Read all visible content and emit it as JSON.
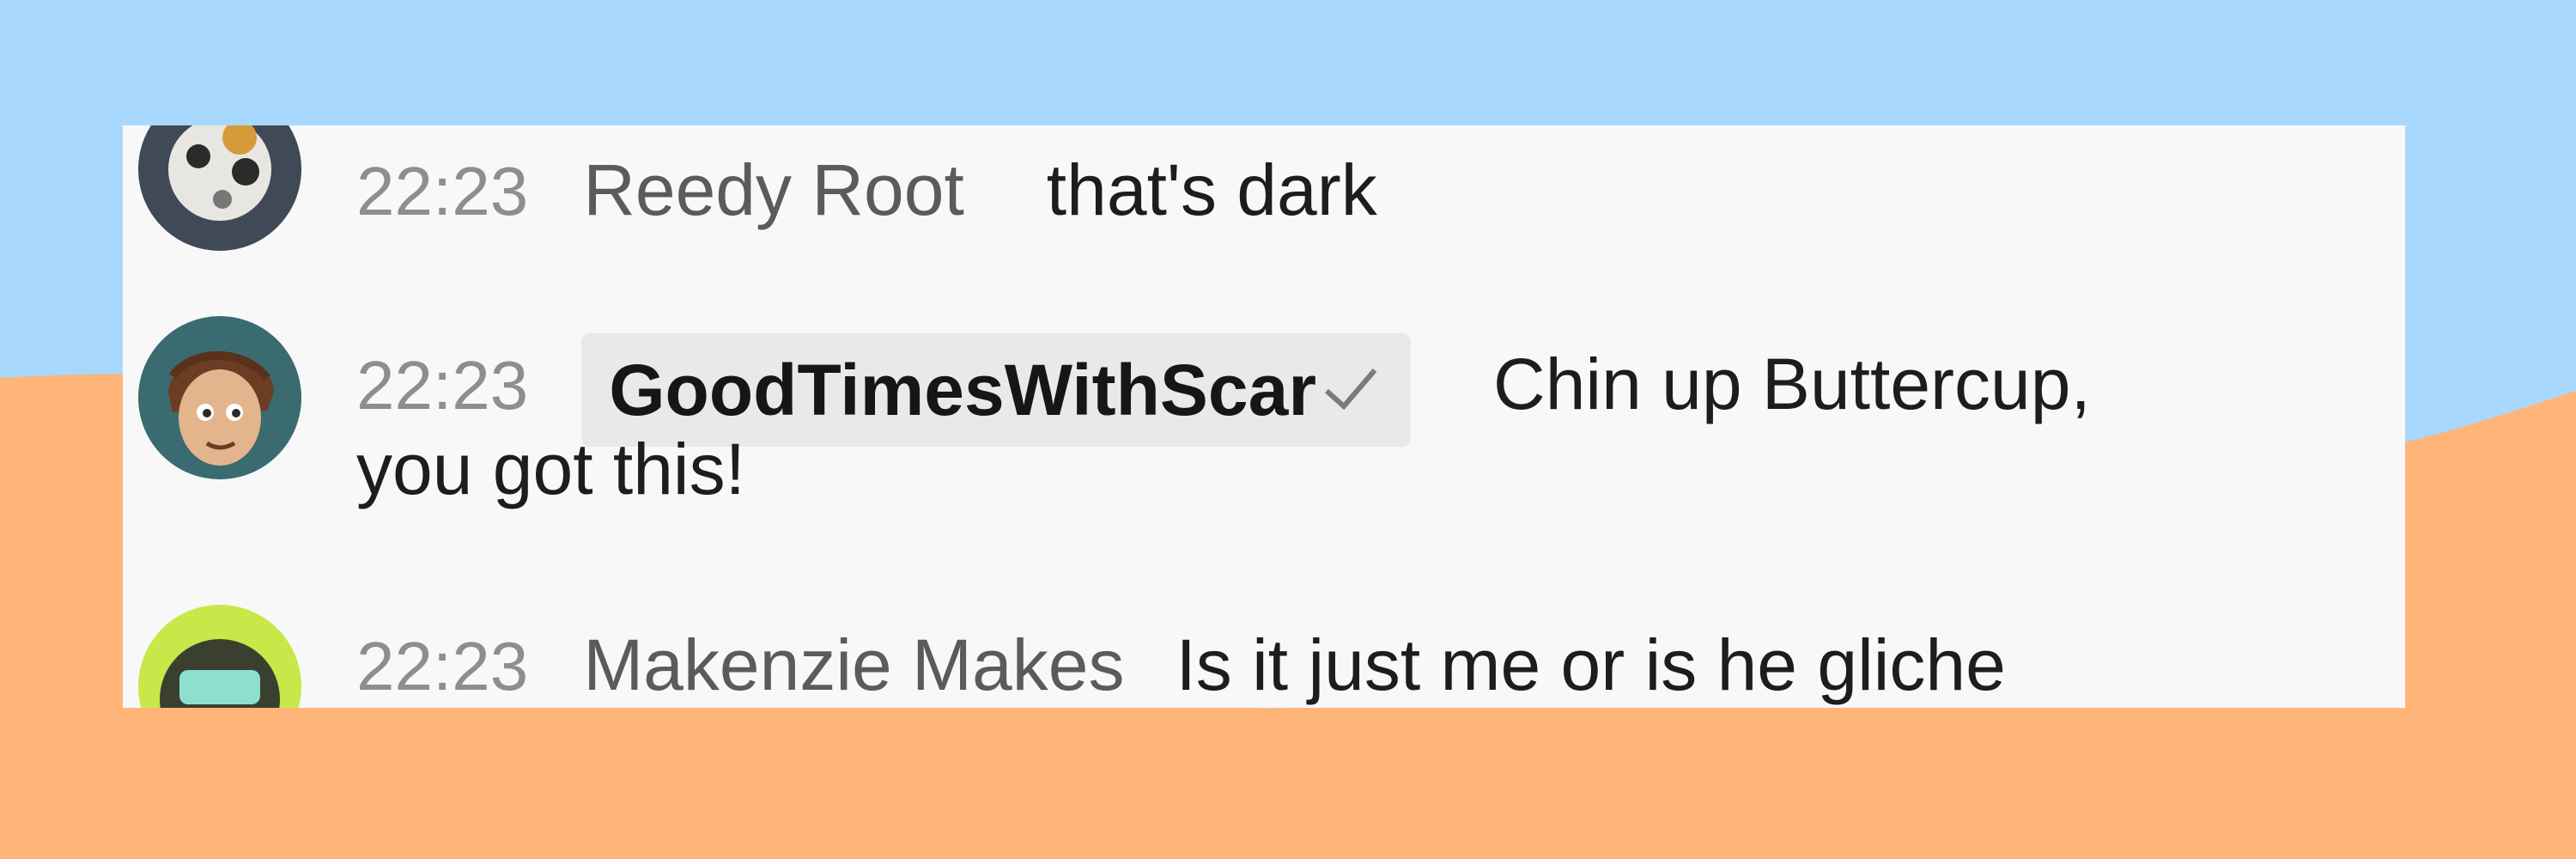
{
  "chat": {
    "messages": [
      {
        "time": "22:23",
        "author": "Reedy Root",
        "text": "that's dark",
        "author_style": "plain"
      },
      {
        "time": "22:23",
        "author": "GoodTimesWithScar",
        "text": "Chin up Buttercup,",
        "text_continued": "you got this!",
        "author_style": "channel-owner",
        "badge_icon": "verified-check-icon"
      },
      {
        "time": "22:23",
        "author": "Makenzie Makes",
        "text": "Is it just me or is he gliche",
        "author_style": "plain"
      }
    ]
  },
  "colors": {
    "background_top": "#a9d8ff",
    "background_bottom": "#ffb577",
    "card": "#f8f8f8",
    "timestamp": "#8e8e8e",
    "author": "#5b5b5b",
    "owner_chip": "#e9e9e9"
  }
}
